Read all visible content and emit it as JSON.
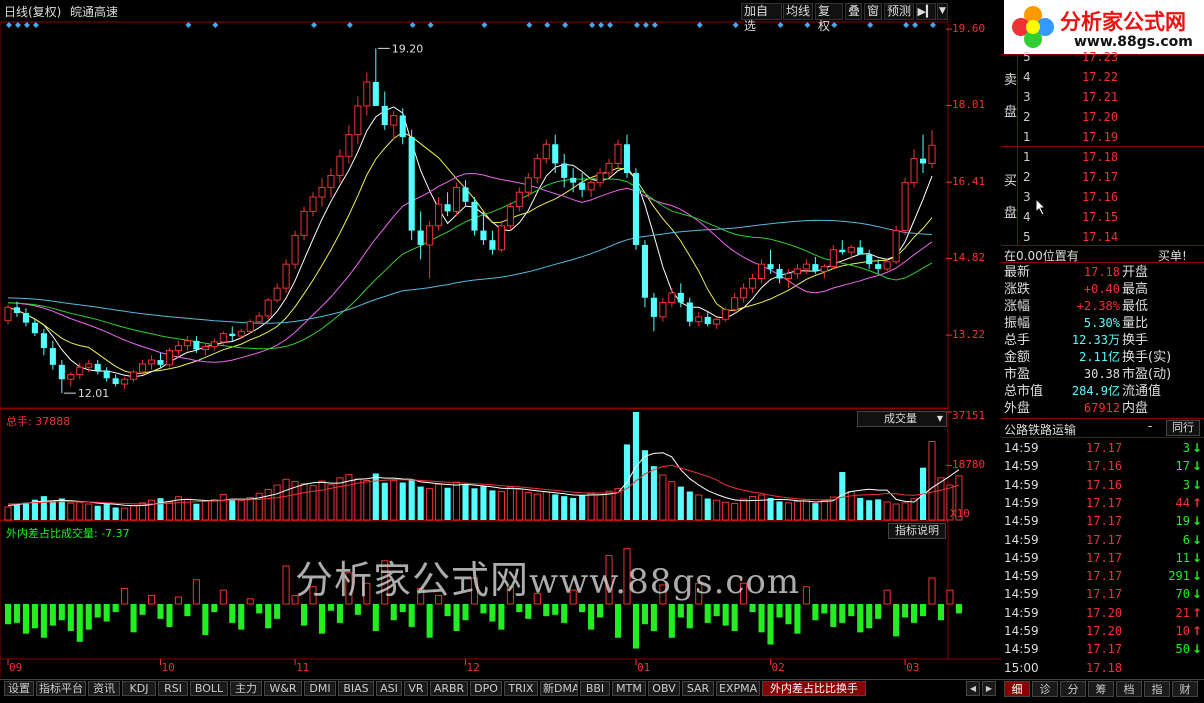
{
  "header": {
    "period_label": "日线(复权)",
    "stock_name": "皖通高速",
    "toolbar": [
      "加自选",
      "均线",
      "复权",
      "叠",
      "窗",
      "预测"
    ],
    "colors": {
      "accent": "#e33",
      "cyan": "#5ff",
      "green": "#2e2",
      "frame": "#8b0000"
    }
  },
  "logo": {
    "name": "分析家公式网",
    "url": "www.88gs.com"
  },
  "watermark": {
    "cn": "分析家公式网",
    "url": "www.88gs.com"
  },
  "chart_data": [
    {
      "type": "candlestick",
      "panel": "price",
      "x": [
        "09",
        "10",
        "11",
        "12",
        "01",
        "02",
        "03"
      ],
      "ticks": [
        19.6,
        18.01,
        16.41,
        14.82,
        13.22
      ],
      "ylim": [
        11.7,
        19.75
      ],
      "annotations": [
        {
          "text": "19.20",
          "value": 19.2
        },
        {
          "text": "12.01",
          "value": 12.01
        }
      ],
      "candles": [
        [
          13.52,
          13.85,
          13.45,
          13.8
        ],
        [
          13.8,
          13.92,
          13.6,
          13.68
        ],
        [
          13.68,
          13.78,
          13.4,
          13.48
        ],
        [
          13.48,
          13.55,
          13.2,
          13.26
        ],
        [
          13.26,
          13.35,
          12.8,
          12.95
        ],
        [
          12.95,
          13.1,
          12.5,
          12.6
        ],
        [
          12.6,
          12.7,
          12.01,
          12.3
        ],
        [
          12.3,
          12.45,
          12.15,
          12.4
        ],
        [
          12.4,
          12.65,
          12.3,
          12.55
        ],
        [
          12.55,
          12.7,
          12.45,
          12.62
        ],
        [
          12.62,
          12.7,
          12.4,
          12.48
        ],
        [
          12.48,
          12.55,
          12.25,
          12.32
        ],
        [
          12.32,
          12.4,
          12.15,
          12.2
        ],
        [
          12.2,
          12.35,
          12.1,
          12.3
        ],
        [
          12.3,
          12.5,
          12.25,
          12.45
        ],
        [
          12.45,
          12.7,
          12.4,
          12.62
        ],
        [
          12.62,
          12.8,
          12.5,
          12.7
        ],
        [
          12.7,
          12.85,
          12.55,
          12.6
        ],
        [
          12.6,
          12.95,
          12.55,
          12.9
        ],
        [
          12.9,
          13.1,
          12.8,
          13.0
        ],
        [
          13.0,
          13.2,
          12.9,
          13.1
        ],
        [
          13.1,
          13.2,
          12.85,
          12.92
        ],
        [
          12.92,
          13.05,
          12.8,
          12.98
        ],
        [
          12.98,
          13.15,
          12.9,
          13.08
        ],
        [
          13.08,
          13.3,
          13.0,
          13.25
        ],
        [
          13.25,
          13.4,
          13.1,
          13.2
        ],
        [
          13.2,
          13.35,
          13.15,
          13.3
        ],
        [
          13.3,
          13.55,
          13.25,
          13.5
        ],
        [
          13.5,
          13.7,
          13.45,
          13.62
        ],
        [
          13.62,
          14.0,
          13.55,
          13.95
        ],
        [
          13.95,
          14.3,
          13.9,
          14.2
        ],
        [
          14.2,
          14.8,
          14.1,
          14.7
        ],
        [
          14.7,
          15.4,
          14.6,
          15.3
        ],
        [
          15.3,
          15.9,
          15.2,
          15.8
        ],
        [
          15.8,
          16.2,
          15.7,
          16.1
        ],
        [
          16.1,
          16.5,
          15.9,
          16.3
        ],
        [
          16.3,
          16.7,
          16.1,
          16.55
        ],
        [
          16.55,
          17.1,
          16.4,
          16.95
        ],
        [
          16.95,
          17.6,
          16.8,
          17.4
        ],
        [
          17.4,
          18.2,
          17.2,
          18.0
        ],
        [
          18.0,
          18.7,
          17.8,
          18.5
        ],
        [
          18.5,
          19.2,
          18.3,
          18.0
        ],
        [
          18.0,
          18.3,
          17.5,
          17.6
        ],
        [
          17.6,
          17.9,
          17.3,
          17.8
        ],
        [
          17.8,
          17.95,
          17.2,
          17.35
        ],
        [
          17.35,
          17.5,
          15.2,
          15.4
        ],
        [
          15.4,
          15.8,
          14.8,
          15.1
        ],
        [
          15.1,
          15.6,
          14.4,
          15.5
        ],
        [
          15.5,
          16.1,
          15.4,
          15.95
        ],
        [
          15.95,
          16.2,
          15.7,
          15.8
        ],
        [
          15.8,
          16.4,
          15.7,
          16.3
        ],
        [
          16.3,
          16.45,
          15.9,
          16.0
        ],
        [
          16.0,
          16.1,
          15.3,
          15.4
        ],
        [
          15.4,
          15.8,
          15.1,
          15.2
        ],
        [
          15.2,
          15.4,
          14.9,
          15.0
        ],
        [
          15.0,
          15.6,
          14.95,
          15.5
        ],
        [
          15.5,
          16.0,
          15.4,
          15.9
        ],
        [
          15.9,
          16.3,
          15.8,
          16.2
        ],
        [
          16.2,
          16.6,
          16.1,
          16.5
        ],
        [
          16.5,
          17.0,
          16.4,
          16.9
        ],
        [
          16.9,
          17.3,
          16.8,
          17.2
        ],
        [
          17.2,
          17.4,
          16.6,
          16.8
        ],
        [
          16.8,
          17.0,
          16.3,
          16.5
        ],
        [
          16.5,
          16.7,
          16.2,
          16.4
        ],
        [
          16.4,
          16.6,
          16.1,
          16.25
        ],
        [
          16.25,
          16.5,
          16.1,
          16.4
        ],
        [
          16.4,
          16.7,
          16.3,
          16.6
        ],
        [
          16.6,
          16.9,
          16.5,
          16.8
        ],
        [
          16.8,
          17.3,
          16.7,
          17.2
        ],
        [
          17.2,
          17.4,
          16.5,
          16.6
        ],
        [
          16.6,
          16.7,
          15.0,
          15.1
        ],
        [
          15.1,
          15.2,
          13.8,
          14.0
        ],
        [
          14.0,
          14.1,
          13.3,
          13.6
        ],
        [
          13.6,
          14.0,
          13.5,
          13.9
        ],
        [
          13.9,
          14.2,
          13.8,
          14.1
        ],
        [
          14.1,
          14.3,
          13.8,
          13.9
        ],
        [
          13.9,
          14.0,
          13.4,
          13.5
        ],
        [
          13.5,
          13.7,
          13.4,
          13.6
        ],
        [
          13.6,
          13.7,
          13.4,
          13.45
        ],
        [
          13.45,
          13.6,
          13.35,
          13.55
        ],
        [
          13.55,
          13.8,
          13.5,
          13.75
        ],
        [
          13.75,
          14.1,
          13.7,
          14.0
        ],
        [
          14.0,
          14.3,
          13.9,
          14.2
        ],
        [
          14.2,
          14.5,
          14.1,
          14.4
        ],
        [
          14.4,
          14.8,
          14.3,
          14.7
        ],
        [
          14.7,
          15.0,
          14.5,
          14.6
        ],
        [
          14.6,
          14.7,
          14.3,
          14.4
        ],
        [
          14.4,
          14.6,
          14.2,
          14.5
        ],
        [
          14.5,
          14.7,
          14.4,
          14.6
        ],
        [
          14.6,
          14.8,
          14.5,
          14.7
        ],
        [
          14.7,
          14.85,
          14.5,
          14.55
        ],
        [
          14.55,
          14.7,
          14.4,
          14.65
        ],
        [
          14.65,
          15.1,
          14.6,
          15.0
        ],
        [
          15.0,
          15.2,
          14.9,
          14.95
        ],
        [
          14.95,
          15.1,
          14.8,
          15.05
        ],
        [
          15.05,
          15.2,
          14.9,
          14.9
        ],
        [
          14.9,
          15.0,
          14.6,
          14.7
        ],
        [
          14.7,
          14.8,
          14.5,
          14.6
        ],
        [
          14.6,
          14.8,
          14.55,
          14.75
        ],
        [
          14.75,
          15.5,
          14.7,
          15.4
        ],
        [
          15.4,
          16.5,
          15.3,
          16.4
        ],
        [
          16.4,
          17.1,
          16.3,
          16.9
        ],
        [
          16.9,
          17.4,
          16.6,
          16.8
        ],
        [
          16.8,
          17.5,
          16.7,
          17.18
        ]
      ]
    },
    {
      "type": "bar",
      "panel": "volume",
      "title": "总手: 37888",
      "indicator": "成交量",
      "ticks": [
        37151,
        18780
      ],
      "unit": "X10",
      "ylim": [
        0,
        37151
      ],
      "values": [
        4500,
        5200,
        6000,
        7000,
        8200,
        6500,
        7400,
        5800,
        6100,
        5500,
        4900,
        5700,
        4300,
        4100,
        5000,
        5900,
        6800,
        7500,
        6200,
        8000,
        7100,
        5600,
        6400,
        7000,
        8800,
        7300,
        6700,
        7700,
        9200,
        10500,
        12000,
        14000,
        13200,
        12500,
        11800,
        13400,
        12100,
        14500,
        15600,
        14100,
        13600,
        16000,
        12800,
        13500,
        12900,
        14000,
        11500,
        10800,
        12300,
        11100,
        13000,
        12400,
        10900,
        11600,
        10200,
        9800,
        11300,
        10600,
        9500,
        8900,
        9700,
        8800,
        8200,
        7600,
        8400,
        9100,
        8700,
        9900,
        10800,
        26000,
        37151,
        24000,
        18500,
        15500,
        13200,
        11500,
        9800,
        8600,
        7400,
        6800,
        6100,
        5700,
        7200,
        8100,
        8600,
        7600,
        6400,
        5900,
        6300,
        7000,
        5800,
        6700,
        7900,
        16500,
        9800,
        7600,
        6800,
        7100,
        6200,
        5500,
        5900,
        7300,
        18000,
        27000,
        14500,
        12000,
        15200
      ],
      "ma5": [
        5000,
        5300,
        5700,
        6200,
        6500,
        6600,
        6800,
        6600,
        6400,
        6200,
        5800,
        5600,
        5400,
        5100,
        4900,
        5000,
        5300,
        5900,
        6400,
        6900,
        7100,
        6900,
        6700,
        6600,
        6800,
        7200,
        7200,
        7200,
        7600,
        8300,
        9000,
        10200,
        11300,
        12200,
        12800,
        13000,
        12700,
        12700,
        13400,
        14000,
        14200,
        14700,
        14400,
        14400,
        14100,
        14000,
        13100,
        12800,
        12500,
        12200,
        12000,
        12300,
        12000,
        11700,
        11400,
        10900,
        10800,
        10800,
        10400,
        10000,
        9700,
        9400,
        9000,
        8600,
        8500,
        8600,
        8700,
        8900,
        9400,
        13000,
        18400,
        21900,
        22900,
        23100,
        21700,
        17300,
        14200,
        12000,
        10100,
        8800,
        7700,
        6900,
        6600,
        6700,
        6800,
        6900,
        7100,
        7000,
        6600,
        6500,
        6200,
        6400,
        6600,
        8800,
        9800,
        10200,
        10600,
        10300,
        10300,
        7100,
        6400,
        6200,
        8600,
        11100,
        13100,
        15100,
        17300
      ],
      "ma10": [
        5500,
        5600,
        5800,
        6000,
        6100,
        6200,
        6300,
        6300,
        6300,
        6200,
        6100,
        5900,
        5800,
        5700,
        5600,
        5500,
        5500,
        5600,
        5700,
        5900,
        6100,
        6300,
        6400,
        6500,
        6700,
        6900,
        7000,
        7000,
        7100,
        7400,
        7700,
        8200,
        8800,
        9400,
        9900,
        10300,
        10900,
        11500,
        12000,
        12700,
        13100,
        13400,
        13700,
        13900,
        13800,
        13800,
        13600,
        13400,
        13200,
        13000,
        12800,
        12700,
        12500,
        12300,
        12100,
        11800,
        11600,
        11400,
        11100,
        10800,
        10500,
        10200,
        9900,
        9600,
        9400,
        9300,
        9300,
        9300,
        9500,
        10800,
        13500,
        15800,
        17300,
        18400,
        18800,
        17900,
        17000,
        16000,
        15000,
        13800,
        12000,
        11000,
        10200,
        9600,
        9200,
        8500,
        8000,
        7600,
        7300,
        7100,
        7000,
        7000,
        7100,
        7800,
        8300,
        8600,
        8700,
        8800,
        9100,
        9000,
        8600,
        8500,
        8900,
        9600,
        10300,
        11000,
        12000
      ]
    },
    {
      "type": "bar",
      "panel": "indicator",
      "title": "外内差占比成交量: -7.37",
      "button": "指标说明",
      "ylim": [
        -40,
        37
      ],
      "values": [
        -15,
        -14,
        -22,
        -18,
        -25,
        -16,
        -12,
        -20,
        -28,
        -19,
        -10,
        -13,
        -6,
        9,
        -21,
        -8,
        5,
        -11,
        -17,
        4,
        -9,
        14,
        -23,
        -6,
        8,
        -14,
        -19,
        3,
        -7,
        -18,
        -11,
        22,
        5,
        -16,
        10,
        -22,
        -5,
        -14,
        18,
        -8,
        12,
        -20,
        25,
        -12,
        -6,
        -17,
        9,
        -25,
        5,
        -9,
        -20,
        -12,
        15,
        -7,
        -13,
        -19,
        10,
        -6,
        -11,
        6,
        -9,
        -8,
        -14,
        8,
        -6,
        -19,
        -10,
        28,
        -25,
        32,
        -33,
        -15,
        -20,
        11,
        -25,
        -10,
        -18,
        12,
        -14,
        -9,
        -16,
        -20,
        12,
        -6,
        -21,
        -30,
        -10,
        -15,
        -22,
        10,
        -12,
        -7,
        -17,
        -14,
        -9,
        -21,
        -18,
        -11,
        8,
        -24,
        -10,
        -14,
        -9,
        15,
        -12,
        8,
        -7
      ]
    }
  ],
  "orderbook": {
    "sell_label": [
      "卖",
      "盘"
    ],
    "buy_label": [
      "买",
      "盘"
    ],
    "sell": [
      {
        "level": "5",
        "price": "17.23"
      },
      {
        "level": "4",
        "price": "17.22"
      },
      {
        "level": "3",
        "price": "17.21"
      },
      {
        "level": "2",
        "price": "17.20"
      },
      {
        "level": "1",
        "price": "17.19"
      }
    ],
    "buy": [
      {
        "level": "1",
        "price": "17.18"
      },
      {
        "level": "2",
        "price": "17.17"
      },
      {
        "level": "3",
        "price": "17.16"
      },
      {
        "level": "4",
        "price": "17.15"
      },
      {
        "level": "5",
        "price": "17.14"
      }
    ],
    "position_note": "在0.00位置有",
    "buy_single": "买单!"
  },
  "quote": {
    "rows": [
      {
        "l1": "最新",
        "v1": "17.18",
        "c1": "#e33",
        "l2": "开盘"
      },
      {
        "l1": "涨跌",
        "v1": "+0.40",
        "c1": "#e33",
        "l2": "最高"
      },
      {
        "l1": "涨幅",
        "v1": "+2.38%",
        "c1": "#e33",
        "l2": "最低"
      },
      {
        "l1": "振幅",
        "v1": "5.30%",
        "c1": "#5ff",
        "l2": "量比"
      },
      {
        "l1": "总手",
        "v1": "12.33万",
        "c1": "#5ff",
        "l2": "换手"
      },
      {
        "l1": "金额",
        "v1": "2.11亿",
        "c1": "#5ff",
        "l2": "换手(实)"
      },
      {
        "l1": "市盈",
        "v1": "30.38",
        "c1": "#ddd",
        "l2": "市盈(动)"
      },
      {
        "l1": "总市值",
        "v1": "284.9亿",
        "c1": "#5ff",
        "l2": "流通值"
      },
      {
        "l1": "外盘",
        "v1": "67912",
        "c1": "#e33",
        "l2": "内盘"
      }
    ],
    "sector": "公路铁路运输",
    "sector_dash": "-",
    "peer_btn": "同行"
  },
  "ticks": [
    {
      "t": "14:59",
      "p": "17.17",
      "v": "3",
      "d": "dn"
    },
    {
      "t": "14:59",
      "p": "17.16",
      "v": "17",
      "d": "dn"
    },
    {
      "t": "14:59",
      "p": "17.16",
      "v": "3",
      "d": "dn"
    },
    {
      "t": "14:59",
      "p": "17.17",
      "v": "44",
      "d": "up"
    },
    {
      "t": "14:59",
      "p": "17.17",
      "v": "19",
      "d": "dn"
    },
    {
      "t": "14:59",
      "p": "17.17",
      "v": "6",
      "d": "dn"
    },
    {
      "t": "14:59",
      "p": "17.17",
      "v": "11",
      "d": "dn"
    },
    {
      "t": "14:59",
      "p": "17.17",
      "v": "291",
      "d": "dn"
    },
    {
      "t": "14:59",
      "p": "17.17",
      "v": "70",
      "d": "dn"
    },
    {
      "t": "14:59",
      "p": "17.20",
      "v": "21",
      "d": "up"
    },
    {
      "t": "14:59",
      "p": "17.20",
      "v": "10",
      "d": "up"
    },
    {
      "t": "14:59",
      "p": "17.17",
      "v": "50",
      "d": "dn"
    },
    {
      "t": "15:00",
      "p": "17.18",
      "v": "",
      "d": ""
    }
  ],
  "bottom_tabs": [
    "设置",
    "指标平台",
    "资讯",
    "KDJ",
    "RSI",
    "BOLL",
    "主力",
    "W&R",
    "DMI",
    "BIAS",
    "ASI",
    "VR",
    "ARBR",
    "DPO",
    "TRIX",
    "新DMA",
    "BBI",
    "MTM",
    "OBV",
    "SAR",
    "EXPMA",
    "外内差占比比换手"
  ],
  "right_tabs": [
    "细",
    "诊",
    "分",
    "筹",
    "档",
    "指",
    "财"
  ]
}
